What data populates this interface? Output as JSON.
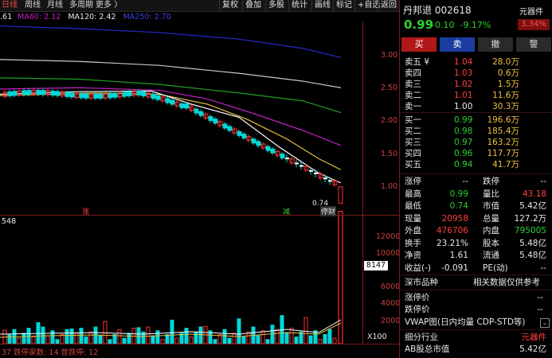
{
  "toolbar": {
    "tabs": [
      "日线",
      "周线",
      "月线",
      "多周期",
      "更多 〉"
    ],
    "tools": [
      "复权",
      "叠加",
      "多股",
      "统计",
      "画线",
      "标记",
      "+自选",
      "返回"
    ]
  },
  "ma_legend": {
    "ma_prev": ".61",
    "ma60": "MA60: 2.12",
    "ma120": "MA120: 2.42",
    "ma250": "MA250: 2.70"
  },
  "price_axis": [
    "3.00",
    "2.50",
    "2.00",
    "1.50",
    "1.00"
  ],
  "chart_annotations": {
    "zhang": "涨",
    "jian": "减",
    "tingpai": "停财",
    "low_label": "0.74"
  },
  "volume": {
    "top_label": "548",
    "axis": [
      "12000",
      "10000",
      "8000",
      "6000",
      "4000",
      "2000"
    ],
    "cursor_value": "8147",
    "unit": "X100",
    "bottom_text": "37  跌停家数: 14  曾跌停: 12"
  },
  "stock": {
    "name": "丹邦退",
    "code": "002618",
    "price": "0.99",
    "change": "-0.10",
    "change_pct": "-9.17%",
    "component_label": "元器件",
    "component_pct": "3.34%"
  },
  "buttons": {
    "buy": "买",
    "sell": "卖",
    "cancel": "撤",
    "alert": "警"
  },
  "asks": [
    {
      "label": "卖五 ¥",
      "price": "1.04",
      "vol": "28.0万"
    },
    {
      "label": "卖四",
      "price": "1.03",
      "vol": "0.6万"
    },
    {
      "label": "卖三",
      "price": "1.02",
      "vol": "1.5万"
    },
    {
      "label": "卖二",
      "price": "1.01",
      "vol": "11.6万"
    },
    {
      "label": "卖一",
      "price": "1.00",
      "vol": "30.3万"
    }
  ],
  "bids": [
    {
      "label": "买一",
      "price": "0.99",
      "vol": "196.6万"
    },
    {
      "label": "买二",
      "price": "0.98",
      "vol": "185.4万"
    },
    {
      "label": "买三",
      "price": "0.97",
      "vol": "163.2万"
    },
    {
      "label": "买四",
      "price": "0.96",
      "vol": "117.7万"
    },
    {
      "label": "买五",
      "price": "0.94",
      "vol": "41.7万"
    }
  ],
  "stats": [
    {
      "k1": "涨停",
      "v1": "--",
      "k2": "跌停",
      "v2": "--"
    },
    {
      "k1": "最高",
      "v1": "0.99",
      "k2": "量比",
      "v2": "43.18"
    },
    {
      "k1": "最低",
      "v1": "0.74",
      "k2": "市值",
      "v2": "5.42亿"
    },
    {
      "k1": "现量",
      "v1": "20958",
      "k2": "总量",
      "v2": "127.2万"
    },
    {
      "k1": "外盘",
      "v1": "476706",
      "k2": "内盘",
      "v2": "795005"
    },
    {
      "k1": "换手",
      "v1": "23.21%",
      "k2": "股本",
      "v2": "5.48亿"
    },
    {
      "k1": "净资",
      "v1": "1.61",
      "k2": "流通",
      "v2": "5.48亿"
    },
    {
      "k1": "收益(-)",
      "v1": "-0.091",
      "k2": "PE(动)",
      "v2": "--"
    }
  ],
  "market": {
    "title": "深市品种",
    "ref_note": "相关数据仅供参考",
    "limit_up_label": "涨停价",
    "limit_up_val": "--",
    "limit_down_label": "跌停价",
    "limit_down_val": "--",
    "vwap_label": "VWAP图(日内均量 CDP-STD等)",
    "industry_label": "细分行业",
    "industry_val": "元器件",
    "ab_label": "AB股总市值",
    "ab_val": "5.42亿"
  },
  "colors": {
    "up": "#ff4040",
    "down": "#2fd12f",
    "ma250": "#2828d0",
    "ma120": "#20a020",
    "ma60": "#c020c0",
    "ma_yellow": "#e8c040",
    "bar_up": "#ff3030",
    "bar_down": "#00d8d8"
  }
}
